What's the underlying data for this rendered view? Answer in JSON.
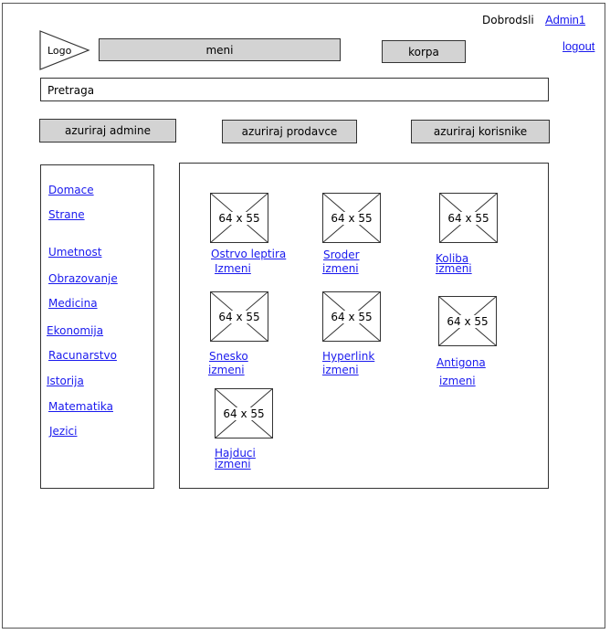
{
  "header": {
    "greeting": "Dobrodsli",
    "user": "Admin1",
    "logout": "logout",
    "logo": "Logo",
    "menu": "meni",
    "cart": "korpa"
  },
  "search": {
    "placeholder": "Pretraga"
  },
  "admin_buttons": [
    "azuriraj admine",
    "azuriraj prodavce",
    "azuriraj korisnike"
  ],
  "categories": [
    "Domace",
    "Strane",
    "Umetnost",
    "Obrazovanje",
    "Medicina",
    "Ekonomija",
    "Racunarstvo",
    "Istorija",
    "Matematika",
    "Jezici"
  ],
  "products": [
    {
      "image_label": "64 x 55",
      "title": "Ostrvo leptira",
      "edit": "Izmeni"
    },
    {
      "image_label": "64 x 55",
      "title": "Sroder",
      "edit": "izmeni"
    },
    {
      "image_label": "64 x 55",
      "title": "Koliba",
      "edit": "izmeni"
    },
    {
      "image_label": "64 x 55",
      "title": "Snesko",
      "edit": "izmeni"
    },
    {
      "image_label": "64 x 55",
      "title": "Hyperlink",
      "edit": "izmeni"
    },
    {
      "image_label": "64 x 55",
      "title": "Antigona",
      "edit": "izmeni"
    },
    {
      "image_label": "64 x 55",
      "title": "Hajduci",
      "edit": "izmeni"
    }
  ]
}
